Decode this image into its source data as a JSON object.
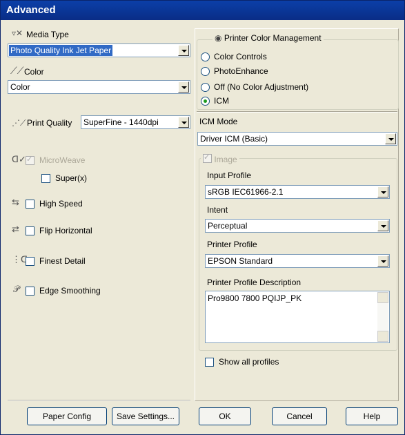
{
  "window": {
    "title": "Advanced"
  },
  "left": {
    "media_type": {
      "label": "Media Type",
      "value": "Photo Quality Ink Jet Paper",
      "icon": "media-type-icon"
    },
    "color": {
      "label": "Color",
      "value": "Color",
      "icon": "color-icon"
    },
    "print_quality": {
      "label": "Print Quality",
      "value": "SuperFine - 1440dpi",
      "icon": "print-quality-icon"
    },
    "microweave": {
      "label": "MicroWeave",
      "checked": true,
      "enabled": false
    },
    "super": {
      "label": "Super(x)",
      "checked": false
    },
    "high_speed": {
      "label": "High Speed",
      "checked": false
    },
    "flip_horizontal": {
      "label": "Flip Horizontal",
      "checked": false
    },
    "finest_detail": {
      "label": "Finest Detail",
      "checked": false
    },
    "edge_smoothing": {
      "label": "Edge Smoothing",
      "checked": false
    }
  },
  "right": {
    "color_management": {
      "title": "Printer Color Management",
      "options": [
        "Color Controls",
        "PhotoEnhance",
        "Off (No Color Adjustment)",
        "ICM"
      ],
      "selected": "ICM"
    },
    "icm_mode": {
      "label": "ICM Mode",
      "value": "Driver ICM (Basic)"
    },
    "image": {
      "label": "Image",
      "checked": true,
      "enabled": false
    },
    "input_profile": {
      "label": "Input Profile",
      "value": "sRGB IEC61966-2.1"
    },
    "intent": {
      "label": "Intent",
      "value": "Perceptual"
    },
    "printer_profile": {
      "label": "Printer Profile",
      "value": "EPSON Standard"
    },
    "printer_profile_description": {
      "label": "Printer Profile Description",
      "value": "Pro9800 7800 PQIJP_PK"
    },
    "show_all_profiles": {
      "label": "Show all profiles",
      "checked": false
    }
  },
  "buttons": {
    "paper_config": "Paper Config",
    "save_settings": "Save Settings...",
    "ok": "OK",
    "cancel": "Cancel",
    "help": "Help"
  },
  "colors": {
    "titlebar": "#0a2d86",
    "background": "#ece9d8",
    "selection": "#316ac5"
  }
}
